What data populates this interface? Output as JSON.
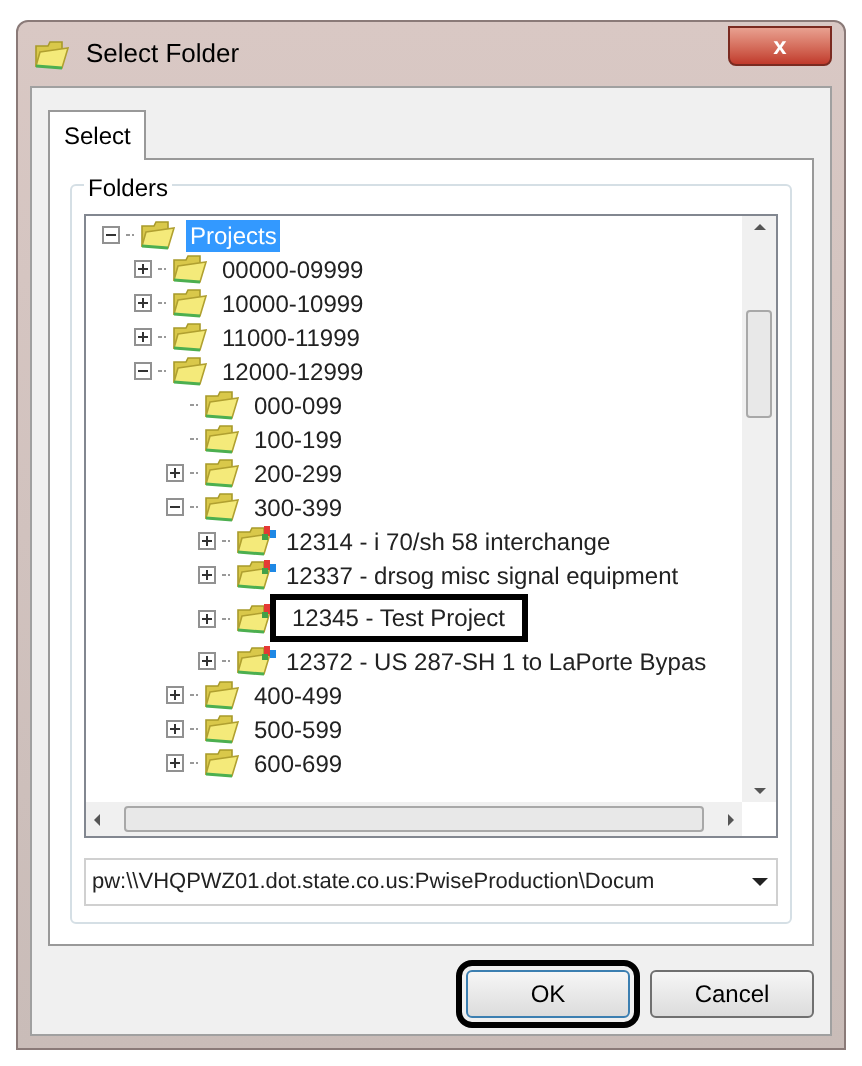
{
  "window": {
    "title": "Select Folder",
    "close": "x"
  },
  "tabs": [
    {
      "label": "Select",
      "selected": true
    }
  ],
  "group": {
    "title": "Folders"
  },
  "tree": [
    {
      "label": "Projects",
      "kind": "folder",
      "expanded": true,
      "selected": true,
      "marked": false,
      "children": [
        {
          "label": "00000-09999",
          "kind": "folder",
          "expanded": false,
          "selected": false,
          "marked": false
        },
        {
          "label": "10000-10999",
          "kind": "folder",
          "expanded": false,
          "selected": false,
          "marked": false
        },
        {
          "label": "11000-11999",
          "kind": "folder",
          "expanded": false,
          "selected": false,
          "marked": false
        },
        {
          "label": "12000-12999",
          "kind": "folder",
          "expanded": true,
          "selected": false,
          "marked": false,
          "children": [
            {
              "label": "000-099",
              "kind": "folder",
              "selected": false,
              "marked": false
            },
            {
              "label": "100-199",
              "kind": "folder",
              "selected": false,
              "marked": false
            },
            {
              "label": "200-299",
              "kind": "folder",
              "expanded": false,
              "selected": false,
              "marked": false
            },
            {
              "label": "300-399",
              "kind": "folder",
              "expanded": true,
              "selected": false,
              "marked": false,
              "children": [
                {
                  "label": "12314 - i 70/sh 58 interchange",
                  "kind": "project",
                  "expanded": false,
                  "selected": false,
                  "marked": false
                },
                {
                  "label": "12337 - drsog misc signal equipment",
                  "kind": "project",
                  "expanded": false,
                  "selected": false,
                  "marked": false
                },
                {
                  "label": "12345 - Test Project",
                  "kind": "project",
                  "expanded": false,
                  "selected": false,
                  "marked": true
                },
                {
                  "label": "12372 - US 287-SH 1 to LaPorte Bypas",
                  "kind": "project",
                  "expanded": false,
                  "selected": false,
                  "marked": false
                }
              ]
            },
            {
              "label": "400-499",
              "kind": "folder",
              "expanded": false,
              "selected": false,
              "marked": false
            },
            {
              "label": "500-599",
              "kind": "folder",
              "expanded": false,
              "selected": false,
              "marked": false
            },
            {
              "label": "600-699",
              "kind": "folder",
              "expanded": false,
              "selected": false,
              "marked": false
            }
          ]
        }
      ]
    }
  ],
  "path": {
    "value": "pw:\\\\VHQPWZ01.dot.state.co.us:PwiseProduction\\Docum"
  },
  "buttons": [
    {
      "label": "OK",
      "marked": true
    },
    {
      "label": "Cancel",
      "marked": false
    }
  ]
}
